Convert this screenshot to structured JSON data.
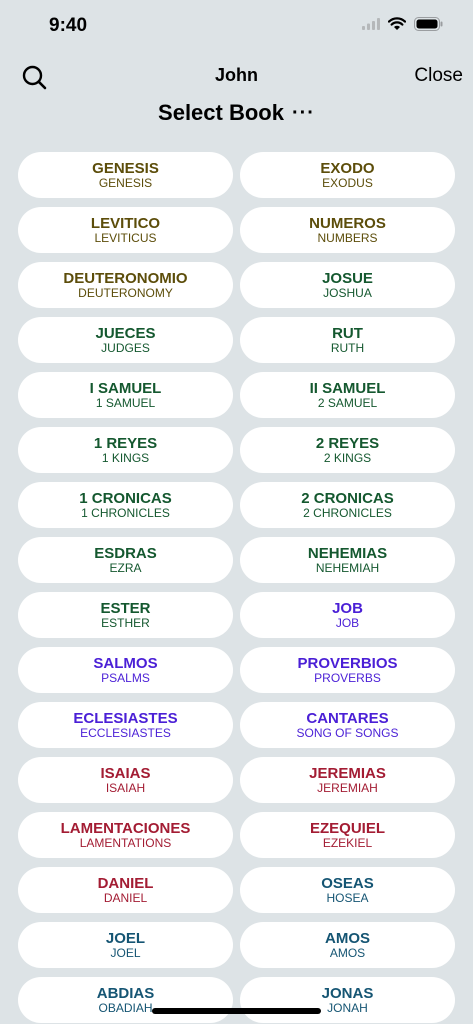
{
  "status": {
    "time": "9:40"
  },
  "nav": {
    "title": "John",
    "close_label": "Close"
  },
  "section": {
    "title": "Select Book",
    "more_label": "···"
  },
  "colors": {
    "law": "#5c4d0a",
    "history": "#14582f",
    "poetry": "#4a1fd6",
    "major_prophets": "#a31c33",
    "minor_prophets": "#155573"
  },
  "books": [
    {
      "es": "GENESIS",
      "en": "GENESIS",
      "group": "law"
    },
    {
      "es": "EXODO",
      "en": "EXODUS",
      "group": "law"
    },
    {
      "es": "LEVITICO",
      "en": "LEVITICUS",
      "group": "law"
    },
    {
      "es": "NUMEROS",
      "en": "NUMBERS",
      "group": "law"
    },
    {
      "es": "DEUTERONOMIO",
      "en": "DEUTERONOMY",
      "group": "law"
    },
    {
      "es": "JOSUE",
      "en": "JOSHUA",
      "group": "hist"
    },
    {
      "es": "JUECES",
      "en": "JUDGES",
      "group": "hist"
    },
    {
      "es": "RUT",
      "en": "RUTH",
      "group": "hist"
    },
    {
      "es": "I SAMUEL",
      "en": "1 SAMUEL",
      "group": "hist"
    },
    {
      "es": "II SAMUEL",
      "en": "2 SAMUEL",
      "group": "hist"
    },
    {
      "es": "1 REYES",
      "en": "1 KINGS",
      "group": "hist"
    },
    {
      "es": "2 REYES",
      "en": "2 KINGS",
      "group": "hist"
    },
    {
      "es": "1 CRONICAS",
      "en": "1 CHRONICLES",
      "group": "hist"
    },
    {
      "es": "2 CRONICAS",
      "en": "2 CHRONICLES",
      "group": "hist"
    },
    {
      "es": "ESDRAS",
      "en": "EZRA",
      "group": "hist"
    },
    {
      "es": "NEHEMIAS",
      "en": "NEHEMIAH",
      "group": "hist"
    },
    {
      "es": "ESTER",
      "en": "ESTHER",
      "group": "hist"
    },
    {
      "es": "JOB",
      "en": "JOB",
      "group": "poet"
    },
    {
      "es": "SALMOS",
      "en": "PSALMS",
      "group": "poet"
    },
    {
      "es": "PROVERBIOS",
      "en": "PROVERBS",
      "group": "poet"
    },
    {
      "es": "ECLESIASTES",
      "en": "ECCLESIASTES",
      "group": "poet"
    },
    {
      "es": "CANTARES",
      "en": "SONG OF SONGS",
      "group": "poet"
    },
    {
      "es": "ISAIAS",
      "en": "ISAIAH",
      "group": "major"
    },
    {
      "es": "JEREMIAS",
      "en": "JEREMIAH",
      "group": "major"
    },
    {
      "es": "LAMENTACIONES",
      "en": "LAMENTATIONS",
      "group": "major"
    },
    {
      "es": "EZEQUIEL",
      "en": "EZEKIEL",
      "group": "major"
    },
    {
      "es": "DANIEL",
      "en": "DANIEL",
      "group": "major"
    },
    {
      "es": "OSEAS",
      "en": "HOSEA",
      "group": "minor"
    },
    {
      "es": "JOEL",
      "en": "JOEL",
      "group": "minor"
    },
    {
      "es": "AMOS",
      "en": "AMOS",
      "group": "minor"
    },
    {
      "es": "ABDIAS",
      "en": "OBADIAH",
      "group": "minor"
    },
    {
      "es": "JONAS",
      "en": "JONAH",
      "group": "minor"
    }
  ]
}
